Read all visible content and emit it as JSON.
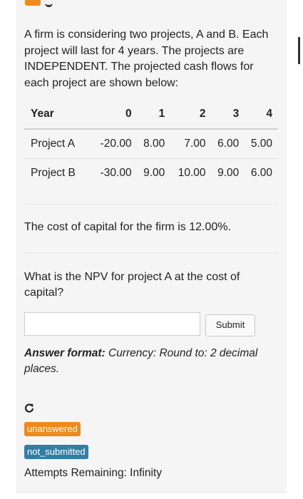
{
  "question": {
    "intro": "A firm is considering two projects, A and B. Each project will last for 4 years. The projects are INDEPENDENT. The projected cash flows for each project are shown below:",
    "table": {
      "headers": [
        "Year",
        "0",
        "1",
        "2",
        "3",
        "4"
      ],
      "rows": [
        [
          "Project A",
          "-20.00",
          "8.00",
          "7.00",
          "6.00",
          "5.00"
        ],
        [
          "Project B",
          "-30.00",
          "9.00",
          "10.00",
          "9.00",
          "6.00"
        ]
      ]
    },
    "cost_of_capital": "The cost of capital for the firm is 12.00%.",
    "prompt": "What is the NPV for project A at the cost of capital?",
    "answer_value": "",
    "submit_label": "Submit",
    "answer_format_label": "Answer format:",
    "answer_format_text": " Currency: Round to: 2 decimal places."
  },
  "status": {
    "unanswered": "unanswered",
    "not_submitted": "not_submitted",
    "attempts": "Attempts Remaining: Infinity"
  },
  "colors": {
    "unanswered_badge": "#ef8a1c",
    "not_submitted_badge": "#2f7fa6"
  }
}
